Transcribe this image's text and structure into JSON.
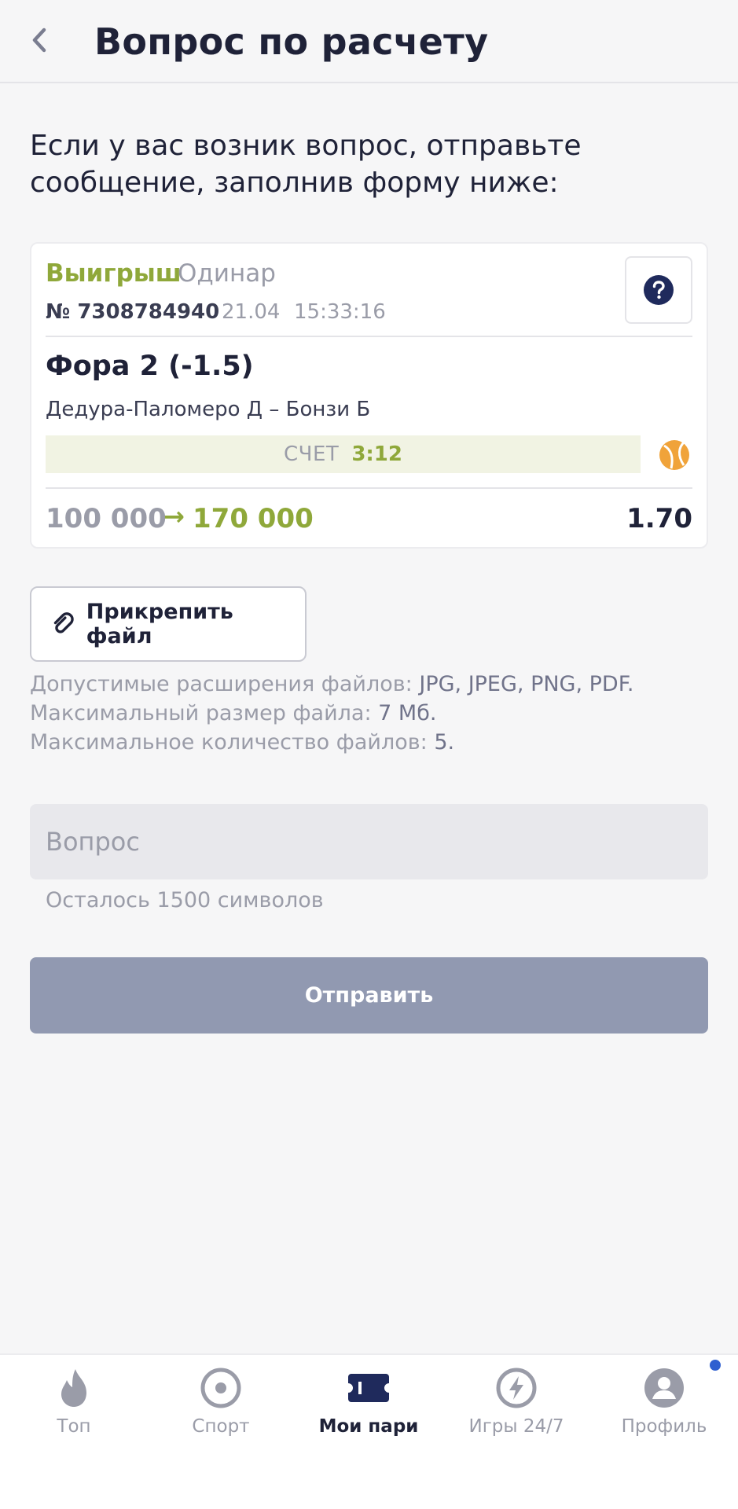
{
  "header": {
    "title": "Вопрос по расчету",
    "back_icon": "chevron-left-icon"
  },
  "intro_text": "Если у вас возник вопрос, отправьте сообщение, заполнив форму ниже:",
  "bet": {
    "status": "Выигрыш",
    "kind": "Одинар",
    "number": "№ 7308784940",
    "date": "21.04",
    "time": "15:33:16",
    "market": "Фора 2 (-1.5)",
    "event": "Дедура-Паломеро Д – Бонзи Б",
    "score_label": "СЧЕТ",
    "score_value": "3:12",
    "stake": "100 000",
    "arrow": "→",
    "payout": "170 000",
    "odds": "1.70",
    "sport_icon": "tennis-ball-icon",
    "help_icon": "question-circle-icon",
    "colors": {
      "win": "#8fa83a",
      "muted": "#9a9ca8",
      "accent_sport": "#f0a33a"
    }
  },
  "attach": {
    "label": "Прикрепить файл",
    "icon": "paperclip-icon"
  },
  "file_hints": {
    "extensions_prefix": "Допустимые расширения файлов: ",
    "extensions_value": "JPG, JPEG, PNG, PDF.",
    "size_prefix": "Максимальный размер файла: ",
    "size_value": "7 Мб.",
    "count_prefix": "Максимальное количество файлов: ",
    "count_value": "5."
  },
  "question": {
    "placeholder": "Вопрос",
    "value": "",
    "counter": "Осталось 1500 символов"
  },
  "submit": {
    "label": "Отправить",
    "color": "#9199b1"
  },
  "tabbar": {
    "tabs": [
      {
        "label": "Топ",
        "icon": "flame-icon",
        "active": false
      },
      {
        "label": "Спорт",
        "icon": "target-icon",
        "active": false
      },
      {
        "label": "Мои пари",
        "icon": "ticket-icon",
        "active": true
      },
      {
        "label": "Игры 24/7",
        "icon": "lightning-icon",
        "active": false
      },
      {
        "label": "Профиль",
        "icon": "user-icon",
        "active": false
      }
    ],
    "notification_color": "#2f5fd0"
  }
}
